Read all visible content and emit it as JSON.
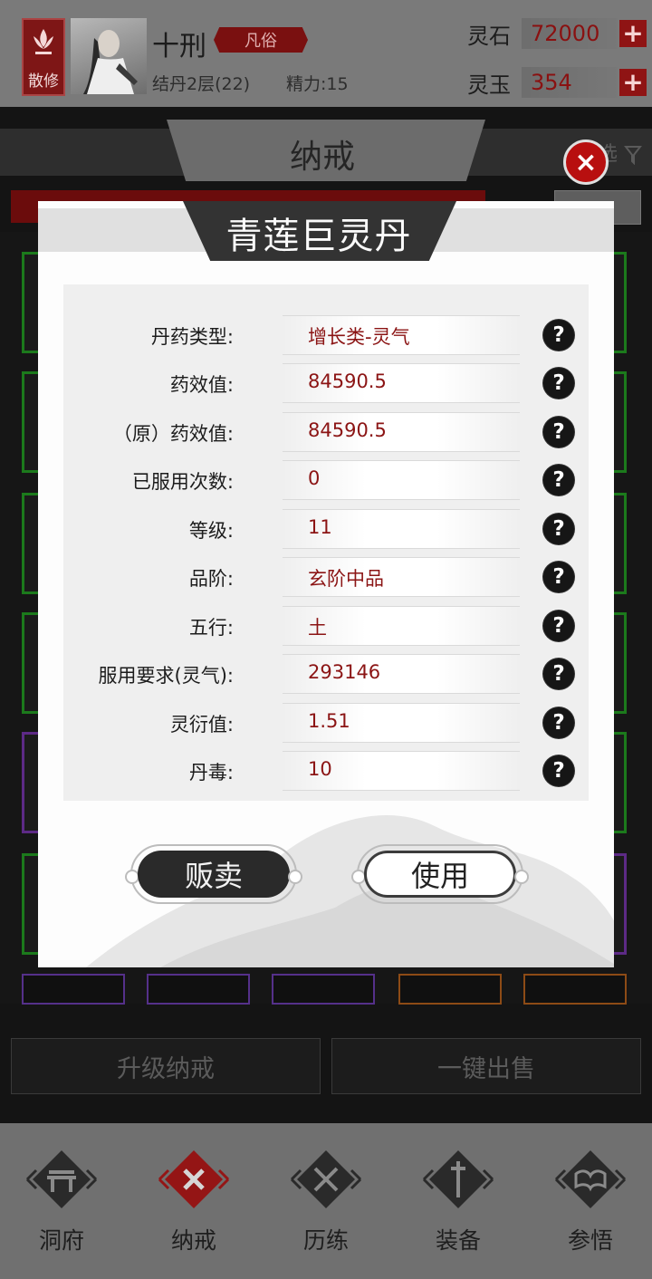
{
  "header": {
    "sect_label": "散修",
    "player_name": "十刑",
    "player_tag": "凡俗",
    "realm": "结丹2层(22)",
    "energy": "精力:15",
    "resources": [
      {
        "label": "灵石",
        "value": "72000",
        "add": "+"
      },
      {
        "label": "灵玉",
        "value": "354",
        "add": "+"
      }
    ]
  },
  "background": {
    "tab_title": "纳戒",
    "filter_label": "选",
    "upgrade_button": "升级纳戒",
    "sell_all_button": "一键出售"
  },
  "close_icon": "×",
  "nav": {
    "items": [
      {
        "label": "洞府",
        "icon": "gate-icon"
      },
      {
        "label": "纳戒",
        "icon": "close-x-icon"
      },
      {
        "label": "历练",
        "icon": "crossed-swords-icon"
      },
      {
        "label": "装备",
        "icon": "sword-icon"
      },
      {
        "label": "参悟",
        "icon": "book-icon"
      }
    ]
  },
  "modal": {
    "title": "青莲巨灵丹",
    "help_glyph": "?",
    "rows": [
      {
        "label": "丹药类型:",
        "value": "增长类-灵气"
      },
      {
        "label": "药效值:",
        "value": "84590.5"
      },
      {
        "label": "（原）药效值:",
        "value": "84590.5"
      },
      {
        "label": "已服用次数:",
        "value": "0"
      },
      {
        "label": "等级:",
        "value": "11"
      },
      {
        "label": "品阶:",
        "value": "玄阶中品"
      },
      {
        "label": "五行:",
        "value": "土"
      },
      {
        "label": "服用要求(灵气):",
        "value": "293146"
      },
      {
        "label": "灵衍值:",
        "value": "1.51"
      },
      {
        "label": "丹毒:",
        "value": "10"
      }
    ],
    "sell_button": "贩卖",
    "use_button": "使用"
  },
  "colors": {
    "accent_red": "#8b1414",
    "close_red": "#b80f0f",
    "common_green": "#1c7a1c",
    "rare_purple": "#5d2a86",
    "epic_orange": "#8d4b16"
  }
}
